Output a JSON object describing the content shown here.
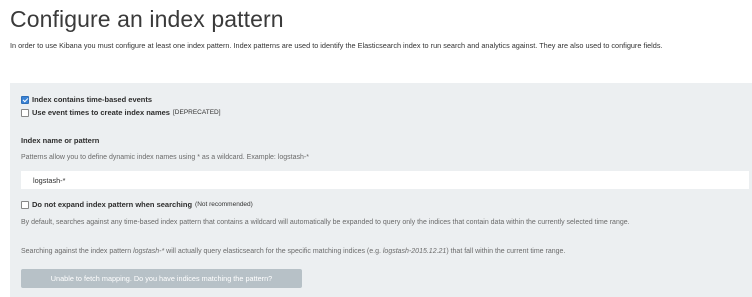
{
  "header": {
    "title": "Configure an index pattern",
    "intro": "In order to use Kibana you must configure at least one index pattern. Index patterns are used to identify the Elasticsearch index to run search and analytics against. They are also used to configure fields."
  },
  "form": {
    "time_based": {
      "label": "Index contains time-based events",
      "checked": true
    },
    "event_times": {
      "label": "Use event times to create index names",
      "tag": "[DEPRECATED]",
      "checked": false
    },
    "index_name": {
      "label": "Index name or pattern",
      "hint": "Patterns allow you to define dynamic index names using * as a wildcard. Example: logstash-*",
      "value": "logstash-*"
    },
    "no_expand": {
      "label": "Do not expand index pattern when searching",
      "tag": "(Not recommended)",
      "checked": false
    },
    "expand_desc": "By default, searches against any time-based index pattern that contains a wildcard will automatically be expanded to query only the indices that contain data within the currently selected time range.",
    "query_desc_prefix": "Searching against the index pattern ",
    "query_desc_pattern": "logstash-*",
    "query_desc_middle": " will actually query elasticsearch for the specific matching indices (e.g. ",
    "query_desc_example": "logstash-2015.12.21",
    "query_desc_suffix": ") that fall within the current time range.",
    "submit_label": "Unable to fetch mapping. Do you have indices matching the pattern?"
  },
  "colors": {
    "panel_bg": "#eceff1",
    "button_disabled_bg": "#b7c1c7",
    "checkbox_checked": "#3a83d6"
  }
}
